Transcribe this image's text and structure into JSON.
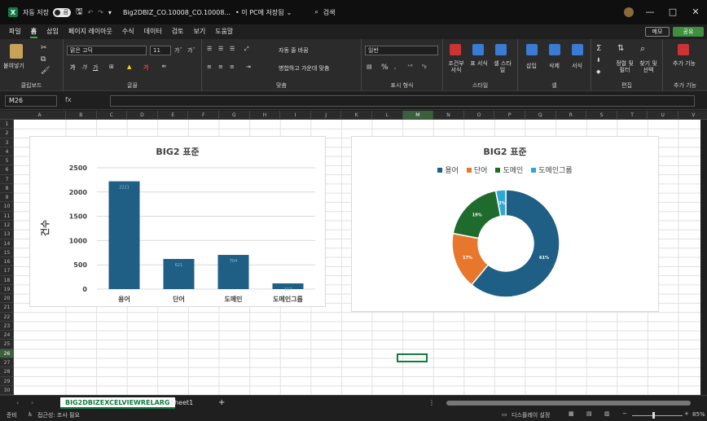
{
  "titlebar": {
    "autosave_label": "자동 저장",
    "autosave_state": "끔",
    "filename": "Big2DBIZ_CO.10008_CO.10008...",
    "save_location": "• 이 PC에 저장됨",
    "search_label": "검색",
    "window_buttons": [
      "—",
      "□",
      "✕"
    ]
  },
  "menu": {
    "items": [
      "파일",
      "홈",
      "삽입",
      "페이지 레이아웃",
      "수식",
      "데이터",
      "검토",
      "보기",
      "도움말"
    ],
    "active_index": 1,
    "memo_label": "메모",
    "share_label": "공유"
  },
  "ribbon": {
    "clipboard": {
      "paste": "붙여넣기",
      "label": "클립보드"
    },
    "font": {
      "name": "맑은 고딕",
      "size": "11",
      "label": "글꼴"
    },
    "alignment": {
      "wrap": "자동 줄 바꿈",
      "merge": "병합하고 가운데 맞춤",
      "label": "맞춤"
    },
    "number": {
      "format": "일반",
      "label": "표시 형식"
    },
    "styles": {
      "cond": "조건부 서식",
      "table": "표 서식",
      "cell": "셀 스타일",
      "label": "스타일"
    },
    "cells": {
      "insert": "삽입",
      "delete": "삭제",
      "format": "서식",
      "label": "셀"
    },
    "editing": {
      "sort": "정렬 및 필터",
      "find": "찾기 및 선택",
      "label": "편집"
    },
    "addins": {
      "label": "추가 기능",
      "btn": "추가 기능"
    }
  },
  "formula_bar": {
    "name_box": "M26",
    "fx": "fx",
    "value": ""
  },
  "columns": [
    "A",
    "B",
    "C",
    "D",
    "E",
    "F",
    "G",
    "H",
    "I",
    "J",
    "K",
    "L",
    "M",
    "N",
    "O",
    "P",
    "Q",
    "R",
    "S",
    "T",
    "U",
    "V"
  ],
  "selected_column": "M",
  "rows": [
    "1",
    "2",
    "3",
    "4",
    "5",
    "6",
    "7",
    "8",
    "9",
    "10",
    "11",
    "12",
    "13",
    "14",
    "15",
    "16",
    "17",
    "18",
    "19",
    "20",
    "21",
    "22",
    "23",
    "24",
    "25",
    "26",
    "27",
    "28",
    "29",
    "30"
  ],
  "selected_row": "26",
  "chart_data": [
    {
      "type": "bar",
      "title": "BIG2 표준",
      "ylabel": "건수",
      "xlabel": "",
      "categories": [
        "용어",
        "단어",
        "도메인",
        "도메인그룹"
      ],
      "values": [
        2221,
        621,
        704,
        117
      ],
      "data_labels": [
        "2221",
        "621",
        "704",
        "117"
      ],
      "ylim": [
        0,
        2500
      ],
      "yticks": [
        "0",
        "500",
        "1000",
        "1500",
        "2000",
        "2500"
      ],
      "color": "#1f5f85",
      "grid": true
    },
    {
      "type": "pie",
      "title": "BIG2 표준",
      "donut": true,
      "categories": [
        "용어",
        "단어",
        "도메인",
        "도메인그룹"
      ],
      "values": [
        61,
        17,
        19,
        3
      ],
      "data_labels": [
        "61%",
        "17%",
        "19%",
        "3%"
      ],
      "colors": [
        "#1f5f85",
        "#e8772e",
        "#1e6b2d",
        "#2ea7d8"
      ],
      "legend": "top"
    }
  ],
  "sheet_tabs": {
    "tabs": [
      "BIG2DBIZEXCELVIEWRELARG",
      "Sheet1"
    ],
    "active_index": 0,
    "add": "+"
  },
  "statusbar": {
    "ready": "준비",
    "accessibility": "접근성: 조사 필요",
    "display_settings": "디스플레이 설정",
    "zoom": "85%"
  }
}
